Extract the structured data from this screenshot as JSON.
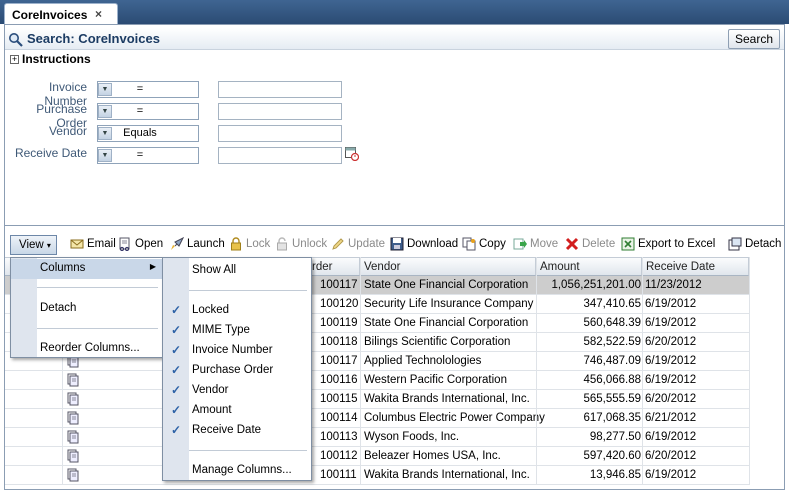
{
  "tab": {
    "title": "CoreInvoices",
    "close_glyph": "×"
  },
  "search": {
    "title": "Search: CoreInvoices",
    "button": "Search",
    "instructions": "Instructions",
    "fields": [
      {
        "label": "Invoice Number",
        "operator": "="
      },
      {
        "label": "Purchase Order",
        "operator": "="
      },
      {
        "label": "Vendor",
        "operator": "Equals"
      },
      {
        "label": "Receive Date",
        "operator": "="
      }
    ]
  },
  "toolbar": {
    "view": "View",
    "email": "Email",
    "open": "Open",
    "launch": "Launch",
    "lock": "Lock",
    "unlock": "Unlock",
    "update": "Update",
    "download": "Download",
    "copy": "Copy",
    "move": "Move",
    "delete": "Delete",
    "export": "Export to Excel",
    "detach": "Detach"
  },
  "table": {
    "headers": {
      "order": "rder",
      "vendor": "Vendor",
      "amount": "Amount",
      "receive_date": "Receive Date"
    },
    "rows": [
      {
        "order": "100117",
        "vendor": "State One Financial Corporation",
        "amount": "1,056,251,201.00",
        "date": "11/23/2012"
      },
      {
        "order": "100120",
        "vendor": "Security Life Insurance Company",
        "amount": "347,410.65",
        "date": "6/19/2012"
      },
      {
        "order": "100119",
        "vendor": "State One Financial Corporation",
        "amount": "560,648.39",
        "date": "6/19/2012"
      },
      {
        "order": "100118",
        "vendor": "Bilings Scientific Corporation",
        "amount": "582,522.59",
        "date": "6/20/2012"
      },
      {
        "order": "100117",
        "vendor": "Applied Technolologies",
        "amount": "746,487.09",
        "date": "6/19/2012"
      },
      {
        "order": "100116",
        "vendor": "Western Pacific Corporation",
        "amount": "456,066.88",
        "date": "6/19/2012"
      },
      {
        "order": "100115",
        "vendor": "Wakita Brands International, Inc.",
        "amount": "565,555.59",
        "date": "6/20/2012"
      },
      {
        "order": "100114",
        "vendor": "Columbus Electric Power Company",
        "amount": "617,068.35",
        "date": "6/21/2012"
      },
      {
        "order": "100113",
        "vendor": "Wyson Foods, Inc.",
        "amount": "98,277.50",
        "date": "6/19/2012"
      },
      {
        "order": "100112",
        "vendor": "Beleazer Homes USA, Inc.",
        "amount": "597,420.60",
        "date": "6/20/2012"
      },
      {
        "order": "100111",
        "vendor": "Wakita Brands International, Inc.",
        "amount": "13,946.85",
        "date": "6/19/2012"
      }
    ]
  },
  "view_menu": {
    "columns": "Columns",
    "detach": "Detach",
    "reorder": "Reorder Columns..."
  },
  "columns_menu": {
    "show_all": "Show All",
    "items": [
      "Locked",
      "MIME Type",
      "Invoice Number",
      "Purchase Order",
      "Vendor",
      "Amount",
      "Receive Date"
    ],
    "manage": "Manage Columns...",
    "check_glyph": "✓"
  },
  "colors": {
    "tabbar": "#2f5381",
    "highlight": "#c9d7e8",
    "selected_row": "#cdcdcd",
    "check": "#2d62a6"
  }
}
